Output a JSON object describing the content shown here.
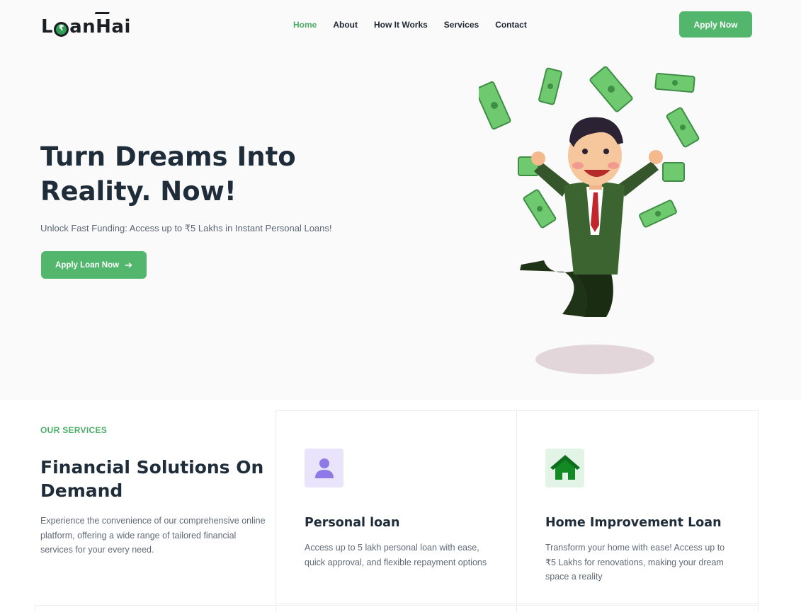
{
  "header": {
    "logo_text_1": "L",
    "logo_text_2": "an ",
    "logo_text_3": "Hai",
    "nav": [
      {
        "label": "Home",
        "active": true
      },
      {
        "label": "About",
        "active": false
      },
      {
        "label": "How It Works",
        "active": false
      },
      {
        "label": "Services",
        "active": false
      },
      {
        "label": "Contact",
        "active": false
      }
    ],
    "apply_button": "Apply Now"
  },
  "hero": {
    "title": "Turn Dreams Into Reality. Now!",
    "subtitle": "Unlock Fast Funding: Access up to ₹5 Lakhs in Instant Personal Loans!",
    "cta": "Apply Loan Now",
    "cta_icon": "arrow-right-icon",
    "illustration": "businessman-jumping-with-money"
  },
  "services": {
    "tag": "OUR SERVICES",
    "title": "Financial Solutions On Demand",
    "description": "Experience the convenience of our comprehensive online platform, offering a wide range of tailored financial services for your every need.",
    "cards": [
      {
        "icon": "user-icon",
        "title": "Personal loan",
        "description": "Access up to 5 lakh personal loan with ease, quick approval, and flexible repayment options"
      },
      {
        "icon": "home-icon",
        "title": "Home Improvement Loan",
        "description": "Transform your home with ease! Access up to ₹5 Lakhs for renovations, making your dream space a reality"
      }
    ]
  },
  "colors": {
    "accent": "#52b76c",
    "heading": "#1f2c3a",
    "hero_bg": "#fafafa"
  }
}
